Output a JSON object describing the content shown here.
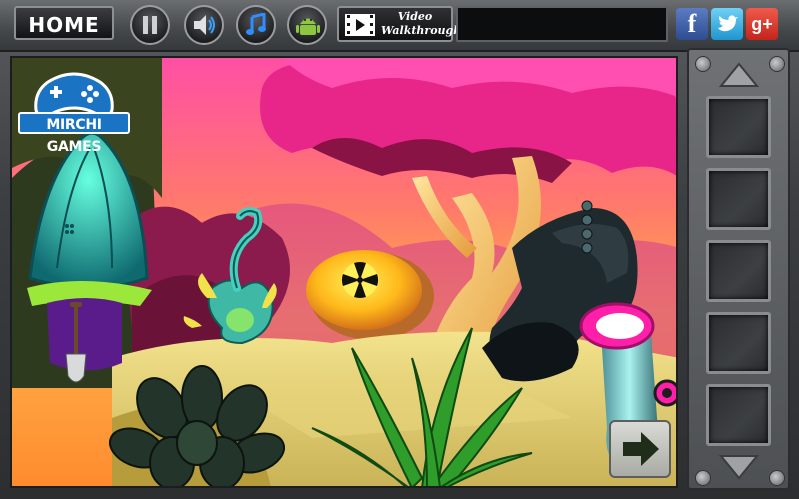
{
  "topbar": {
    "home_label": "HOME",
    "video_label_line1": "Video",
    "video_label_line2": "Walkthrough",
    "message": ""
  },
  "buttons": [
    {
      "name": "pause-button",
      "icon": "pause-icon"
    },
    {
      "name": "sound-button",
      "icon": "speaker-icon"
    },
    {
      "name": "music-button",
      "icon": "music-note-icon"
    },
    {
      "name": "android-button",
      "icon": "android-icon"
    }
  ],
  "social": {
    "facebook": "f",
    "twitter_icon": "twitter-bird-icon",
    "googleplus": "g+"
  },
  "logo": {
    "text": "MIRCHI GAMES",
    "icon": "gamepad-icon"
  },
  "scene": {
    "navigation_icon": "right-arrow-icon",
    "objects": [
      "blue-mushroom",
      "shovel",
      "curly-sprout-plant",
      "glowing-egg-with-symbol",
      "pink-tree",
      "dark-tree-stump-with-buttons",
      "pink-pipe-creature",
      "green-fern",
      "dark-shrub"
    ]
  },
  "inventory": {
    "slot_count": 5,
    "up_icon": "up-arrow-icon",
    "down_icon": "down-arrow-icon"
  },
  "colors": {
    "sky_pink": "#ff3d9a",
    "sky_orange": "#ff9a3a",
    "tree_pink": "#e8268a",
    "ground": "#d9c36a",
    "panel_gray": "#5a5d60"
  }
}
